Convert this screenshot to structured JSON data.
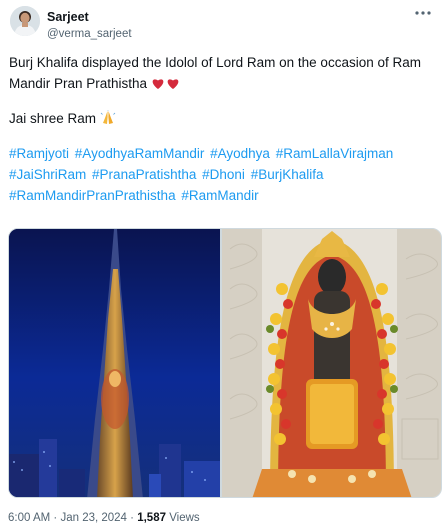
{
  "author": {
    "name": "Sarjeet",
    "handle": "@verma_sarjeet"
  },
  "tweet": {
    "line1": "Burj Khalifa displayed the Idolol of Lord Ram on the occasion of Ram Mandir Pran Prathistha",
    "hearts": "❤️❤️",
    "line2": "Jai shree Ram",
    "pray": "🙏",
    "hashtags": [
      "#Ramjyoti",
      "#AyodhyaRamMandir",
      "#Ayodhya",
      "#RamLallaVirajman",
      "#JaiShriRam",
      "#PranaPratishtha",
      "#Dhoni",
      "#BurjKhalifa",
      "#RamMandirPranPrathistha",
      "#RamMandir"
    ]
  },
  "media": {
    "left_icon": "burj-khalifa-lit-photo",
    "right_icon": "ram-lalla-idol-photo"
  },
  "footer": {
    "time": "6:00 AM",
    "separator": "·",
    "date": "Jan 23, 2024",
    "views_count": "1,587",
    "views_label": "Views"
  },
  "icons": {
    "more": "more-options-icon"
  },
  "colors": {
    "link": "#1d9bf0",
    "secondary_text": "#536471",
    "primary_text": "#0f1419"
  }
}
